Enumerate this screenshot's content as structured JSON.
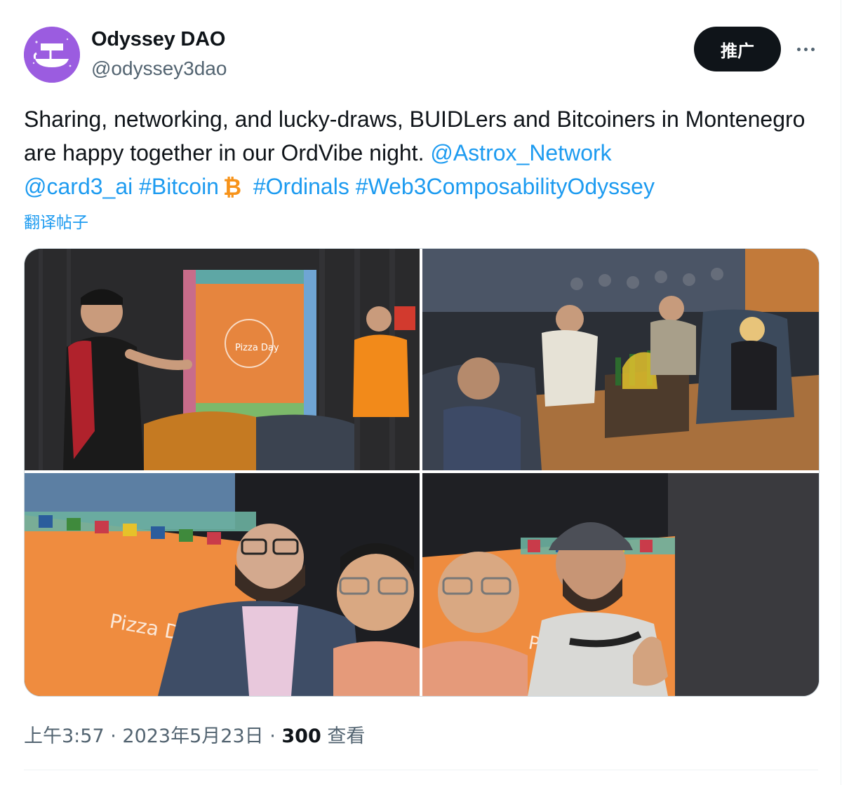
{
  "author": {
    "name": "Odyssey DAO",
    "handle": "@odyssey3dao",
    "avatar_icon": "viking-ship-logo-icon",
    "avatar_color": "#9b5ce0"
  },
  "actions": {
    "promote_label": "推广",
    "more_icon": "more-dots-icon"
  },
  "tweet": {
    "text_part1": "Sharing, networking, and lucky-draws, BUIDLers and Bitcoiners in Montenegro are happy together in our OrdVibe night. ",
    "mention_astrox": "@Astrox_Network",
    "mention_card3": "@card3_ai",
    "hashtag_bitcoin": "#Bitcoin",
    "bitcoin_emoji_icon": "bitcoin-icon",
    "hashtag_ordinals": "#Ordinals",
    "hashtag_web3": "#Web3ComposabilityOdyssey",
    "translate_label": "翻译帖子",
    "link_color": "#1d9bf0"
  },
  "media": {
    "photos": [
      {
        "label": "speaker-presenting-in-front-of-pizza-day-banner"
      },
      {
        "label": "attendees-seated-in-lounge"
      },
      {
        "label": "selfie-two-men-with-banner"
      },
      {
        "label": "selfie-man-in-cap-thumbs-up"
      }
    ]
  },
  "meta": {
    "time": "上午3:57",
    "sep1": " · ",
    "date": "2023年5月23日",
    "sep2": " · ",
    "views_count": "300",
    "views_label": " 查看"
  }
}
